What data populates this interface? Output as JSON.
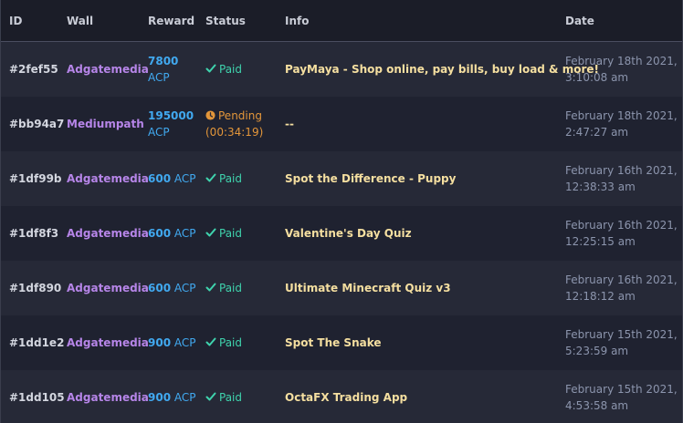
{
  "columns": {
    "id": "ID",
    "wall": "Wall",
    "reward": "Reward",
    "status": "Status",
    "info": "Info",
    "date": "Date"
  },
  "rows": [
    {
      "id": "#2fef55",
      "wall": "Adgatemedia",
      "reward_amount": "7800",
      "reward_unit": "ACP",
      "status": "Paid",
      "info": "PayMaya - Shop online, pay bills, buy load & more!",
      "date_line1": "February 18th 2021,",
      "date_line2": "3:10:08 am"
    },
    {
      "id": "#bb94a7",
      "wall": "Mediumpath",
      "reward_amount": "195000",
      "reward_unit": "ACP",
      "status": "Pending",
      "status_detail": "(00:34:19)",
      "info": "--",
      "date_line1": "February 18th 2021,",
      "date_line2": "2:47:27 am"
    },
    {
      "id": "#1df99b",
      "wall": "Adgatemedia",
      "reward_amount": "600",
      "reward_unit": "ACP",
      "status": "Paid",
      "info": "Spot the Difference - Puppy",
      "date_line1": "February 16th 2021,",
      "date_line2": "12:38:33 am"
    },
    {
      "id": "#1df8f3",
      "wall": "Adgatemedia",
      "reward_amount": "600",
      "reward_unit": "ACP",
      "status": "Paid",
      "info": "Valentine's Day Quiz",
      "date_line1": "February 16th 2021,",
      "date_line2": "12:25:15 am"
    },
    {
      "id": "#1df890",
      "wall": "Adgatemedia",
      "reward_amount": "600",
      "reward_unit": "ACP",
      "status": "Paid",
      "info": "Ultimate Minecraft Quiz v3",
      "date_line1": "February 16th 2021,",
      "date_line2": "12:18:12 am"
    },
    {
      "id": "#1dd1e2",
      "wall": "Adgatemedia",
      "reward_amount": "900",
      "reward_unit": "ACP",
      "status": "Paid",
      "info": "Spot The Snake",
      "date_line1": "February 15th 2021,",
      "date_line2": "5:23:59 am"
    },
    {
      "id": "#1dd105",
      "wall": "Adgatemedia",
      "reward_amount": "900",
      "reward_unit": "ACP",
      "status": "Paid",
      "info": "OctaFX Trading App",
      "date_line1": "February 15th 2021,",
      "date_line2": "4:53:58 am"
    }
  ],
  "icons": {
    "paid": "check-icon",
    "pending": "clock-icon"
  },
  "colors": {
    "wall": "#b685e8",
    "reward": "#41a9f0",
    "paid": "#3fd3ad",
    "pending": "#e3963a",
    "info": "#f5dfa0",
    "date": "#8c95ad"
  }
}
